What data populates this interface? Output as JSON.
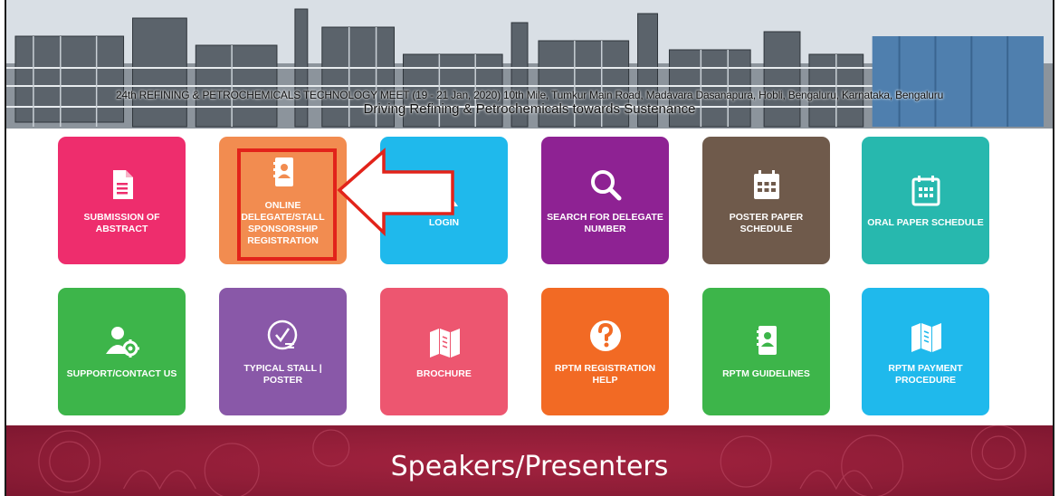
{
  "banner": {
    "meet_line": "24th REFINING & PETROCHEMICALS TECHNOLOGY MEET (19 - 21 Jan, 2020) 10th Mile, Tumkur Main Road, Madavara Dasanapura, Hobli, Bengaluru, Karnataka, Bengaluru",
    "tagline": "Driving Refining & Petrochemicals towards Sustenance"
  },
  "tiles": [
    {
      "label": "SUBMISSION OF ABSTRACT",
      "icon": "document-icon",
      "color": "#ee2d6d"
    },
    {
      "label": "ONLINE DELEGATE/STALL SPONSORSHIP REGISTRATION",
      "icon": "contact-book-icon",
      "color": "#f28c50"
    },
    {
      "label": "LOGIN",
      "icon": "user-icon",
      "color": "#1fb9ec"
    },
    {
      "label": "SEARCH FOR DELEGATE NUMBER",
      "icon": "search-icon",
      "color": "#8e2293"
    },
    {
      "label": "POSTER PAPER SCHEDULE",
      "icon": "calendar-icon",
      "color": "#6f5a4b"
    },
    {
      "label": "ORAL PAPER SCHEDULE",
      "icon": "calendar-outline-icon",
      "color": "#27b8ae"
    },
    {
      "label": "SUPPORT/CONTACT US",
      "icon": "user-gear-icon",
      "color": "#3db54a"
    },
    {
      "label": "TYPICAL STALL | POSTER",
      "icon": "clock-check-icon",
      "color": "#8958a8"
    },
    {
      "label": "BROCHURE",
      "icon": "brochure-icon",
      "color": "#ed5670"
    },
    {
      "label": "RPTM REGISTRATION HELP",
      "icon": "help-circle-icon",
      "color": "#f26a24"
    },
    {
      "label": "RPTM GUIDELINES",
      "icon": "contact-book-icon",
      "color": "#3db54a"
    },
    {
      "label": "RPTM PAYMENT PROCEDURE",
      "icon": "brochure-icon",
      "color": "#1fb9ec"
    }
  ],
  "speakers": {
    "title": "Speakers/Presenters"
  },
  "annotation": {
    "highlight_color": "#e2231a"
  }
}
